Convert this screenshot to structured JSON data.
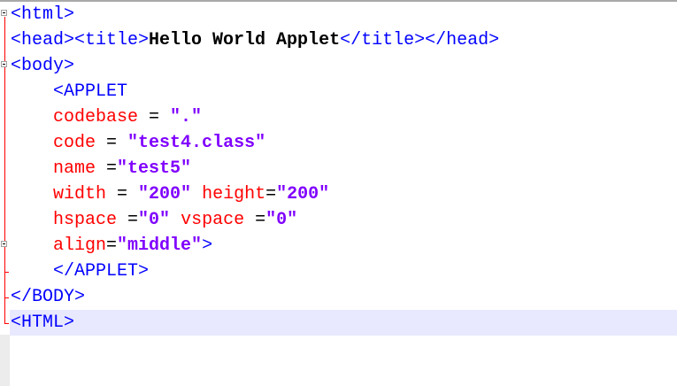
{
  "colors": {
    "tag": "#0000ff",
    "attribute": "#ff0000",
    "value": "#8000ff",
    "caret_line": "#e8e8ff",
    "fold_marker": "#ff0000"
  },
  "lines": [
    {
      "tag_open": "<html>"
    },
    {
      "head_open": "<head>",
      "title_open": "<title>",
      "title_text": "Hello World Applet",
      "title_close": "</title>",
      "head_close": "</head>"
    },
    {
      "tag_open": "<body>"
    },
    {
      "indent": "    ",
      "tag_open": "<APPLET"
    },
    {
      "indent": "    ",
      "attr": "codebase",
      "op": " = ",
      "value": "\".\""
    },
    {
      "indent": "    ",
      "attr": "code",
      "op": " = ",
      "value": "\"test4.class\""
    },
    {
      "indent": "    ",
      "attr": "name",
      "op": " =",
      "value": "\"test5\""
    },
    {
      "indent": "    ",
      "attr": "width",
      "op": " = ",
      "value": "\"200\"",
      "attr2": " height",
      "op2": "=",
      "value2": "\"200\""
    },
    {
      "indent": "    ",
      "attr": "hspace",
      "op": " =",
      "value": "\"0\"",
      "attr2": " vspace",
      "op2": " =",
      "value2": "\"0\""
    },
    {
      "indent": "    ",
      "attr": "align",
      "op": "=",
      "value": "\"middle\"",
      "tag_close": ">"
    },
    {
      "indent": "    ",
      "tag_open": "</APPLET>"
    },
    {
      "tag_open": "</BODY>"
    },
    {
      "tag_open": "<HTML>"
    }
  ]
}
